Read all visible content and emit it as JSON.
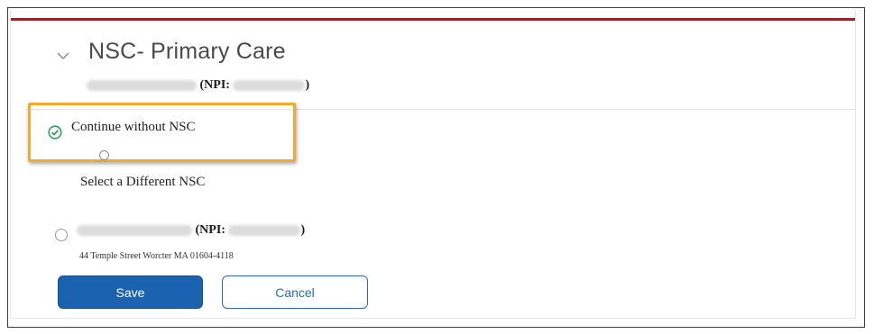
{
  "section": {
    "title": "NSC- Primary Care",
    "npi_label": "(NPI: ",
    "npi_close": ")"
  },
  "options": {
    "continue_label": "Continue without NSC",
    "different_label": "Select a Different NSC",
    "provider_npi_label": "(NPI: ",
    "provider_npi_close": ")",
    "provider_address": "44 Temple Street Worcter MA 01604-4118"
  },
  "buttons": {
    "save_label": "Save",
    "cancel_label": "Cancel"
  },
  "colors": {
    "accent_bar": "#9b2223",
    "highlight_border": "#f2a933",
    "check_green": "#2e9e5b",
    "primary_button": "#1b63b0"
  },
  "icons": {
    "collapse": "chevron-down-icon",
    "selected": "check-circle-icon"
  }
}
